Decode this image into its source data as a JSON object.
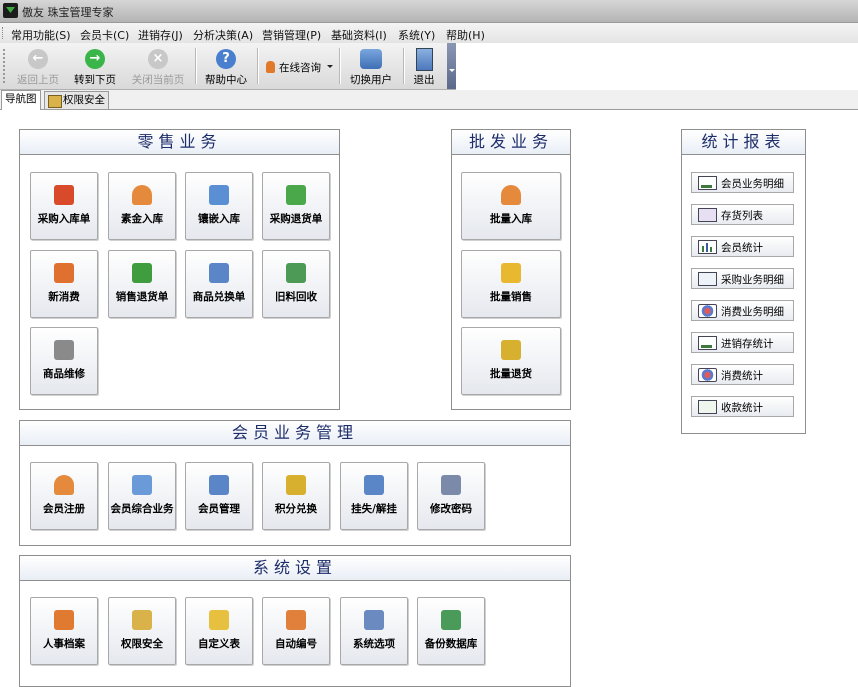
{
  "window": {
    "title": "傲友 珠宝管理专家"
  },
  "menu": [
    {
      "label": "常用功能(S)"
    },
    {
      "label": "会员卡(C)"
    },
    {
      "label": "进销存(J)"
    },
    {
      "label": "分析决策(A)"
    },
    {
      "label": "营销管理(P)"
    },
    {
      "label": "基础资料(I)"
    },
    {
      "label": "系统(Y)"
    },
    {
      "label": "帮助(H)"
    }
  ],
  "toolbar": {
    "back": "返回上页",
    "forward": "转到下页",
    "close_page": "关闭当前页",
    "help": "帮助中心",
    "consult": "在线咨询",
    "switch_user": "切换用户",
    "exit": "退出"
  },
  "tabs": [
    {
      "label": "导航图"
    },
    {
      "label": "权限安全"
    }
  ],
  "retail": {
    "title": "零售业务",
    "buttons": [
      {
        "label": "采购入库单"
      },
      {
        "label": "素金入库"
      },
      {
        "label": "镶嵌入库"
      },
      {
        "label": "采购退货单"
      },
      {
        "label": "新消费"
      },
      {
        "label": "销售退货单"
      },
      {
        "label": "商品兑换单"
      },
      {
        "label": "旧料回收"
      },
      {
        "label": "商品维修"
      }
    ]
  },
  "wholesale": {
    "title": "批发业务",
    "buttons": [
      {
        "label": "批量入库"
      },
      {
        "label": "批量销售"
      },
      {
        "label": "批量退货"
      }
    ]
  },
  "reports": {
    "title": "统计报表",
    "buttons": [
      {
        "label": "会员业务明细"
      },
      {
        "label": "存货列表"
      },
      {
        "label": "会员统计"
      },
      {
        "label": "采购业务明细"
      },
      {
        "label": "消费业务明细"
      },
      {
        "label": "进销存统计"
      },
      {
        "label": "消费统计"
      },
      {
        "label": "收款统计"
      }
    ]
  },
  "member": {
    "title": "会员业务管理",
    "buttons": [
      {
        "label": "会员注册"
      },
      {
        "label": "会员综合业务"
      },
      {
        "label": "会员管理"
      },
      {
        "label": "积分兑换"
      },
      {
        "label": "挂失/解挂"
      },
      {
        "label": "修改密码"
      }
    ]
  },
  "system": {
    "title": "系统设置",
    "buttons": [
      {
        "label": "人事档案"
      },
      {
        "label": "权限安全"
      },
      {
        "label": "自定义表"
      },
      {
        "label": "自动编号"
      },
      {
        "label": "系统选项"
      },
      {
        "label": "备份数据库"
      }
    ]
  }
}
